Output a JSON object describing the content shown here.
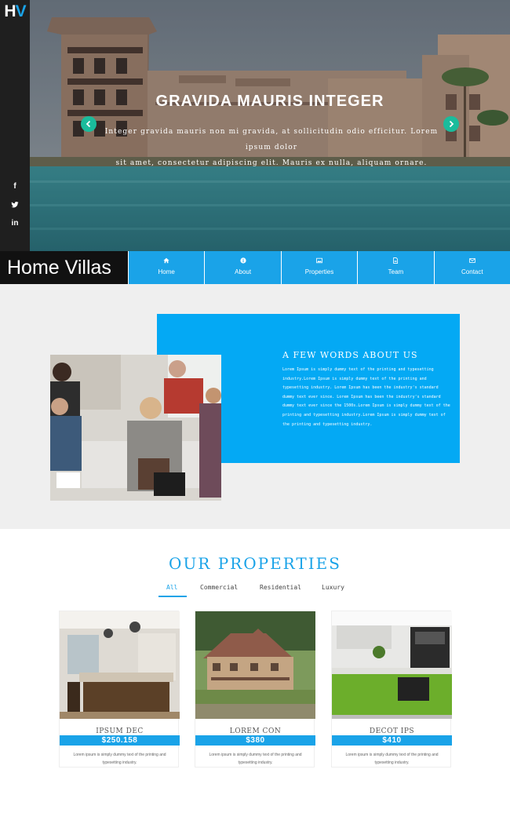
{
  "logo": {
    "h": "H",
    "v": "V"
  },
  "social": [
    "f",
    "twitter-icon",
    "in"
  ],
  "hero": {
    "title": "GRAVIDA MAURIS INTEGER",
    "text_line1": "Integer gravida mauris non mi gravida, at sollicitudin odio efficitur. Lorem ipsum dolor",
    "text_line2": "sit amet, consectetur adipiscing elit. Mauris ex nulla, aliquam ornare."
  },
  "brand": "Home Villas",
  "nav": [
    {
      "label": "Home",
      "icon": "home-icon"
    },
    {
      "label": "About",
      "icon": "info-icon"
    },
    {
      "label": "Properties",
      "icon": "image-icon"
    },
    {
      "label": "Team",
      "icon": "document-icon"
    },
    {
      "label": "Contact",
      "icon": "envelope-icon"
    }
  ],
  "about": {
    "title": "A FEW WORDS ABOUT US",
    "text": "Lorem Ipsum is simply dummy text of the printing and typesetting industry.Lorem Ipsum is simply dummy text of the printing and typesetting industry. Lorem Ipsum has been the industry's standard dummy text ever since. Lorem Ipsum has been the industry's standard dummy text ever since the 1500s.Lorem Ipsum is simply dummy text of the printing and typesetting industry.Lorem Ipsum is simply dummy text of the printing and typesetting industry."
  },
  "properties": {
    "title": "OUR PROPERTIES",
    "filters": [
      "All",
      "Commercial",
      "Residential",
      "Luxury"
    ],
    "active_filter": "All",
    "cards": [
      {
        "name": "IPSUM DEC",
        "price": "$250.158",
        "desc": "Lorem ipsum is simply dummy text of the printing and typesetting industry."
      },
      {
        "name": "LOREM CON",
        "price": "$380",
        "desc": "Lorem ipsum is simply dummy text of the printing and typesetting industry."
      },
      {
        "name": "DECOT IPS",
        "price": "$410",
        "desc": "Lorem ipsum is simply dummy text of the printing and typesetting industry."
      }
    ]
  },
  "colors": {
    "accent": "#1aa3e8",
    "about_box": "#04a9f4",
    "arrow": "#1abc9c",
    "dark": "#111111"
  }
}
